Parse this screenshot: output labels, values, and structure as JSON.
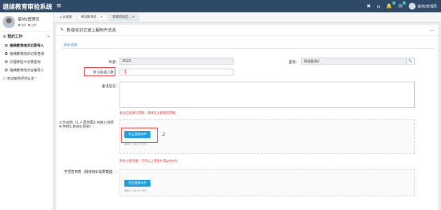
{
  "app": {
    "title": "继续教育审验系统"
  },
  "topbar": {
    "user_name": "基地2管理员",
    "badge_bell": "5",
    "badge_mail": "5"
  },
  "sidebar": {
    "user": {
      "name": "基地2管理员",
      "status_online": "在线",
      "status_work": "工种"
    },
    "section_label": "我的工作",
    "items": [
      {
        "label": "继续教育培训记录导入",
        "active": true
      },
      {
        "label": "继续教育培训记录查询"
      },
      {
        "label": "办理审验卡记录查询"
      },
      {
        "label": "继续教育培训合格导入"
      }
    ],
    "section2_label": "培训基地评估认定"
  },
  "tabs": [
    {
      "label": "仪表盘"
    },
    {
      "label": "继续教育培..."
    },
    {
      "label": "新增培训记..."
    }
  ],
  "panel": {
    "title": "新增培训记录上报附件信息",
    "section": "基本信息",
    "fields": {
      "year_label": "年度:",
      "year_value": "2023",
      "base_label": "基地:",
      "base_value": "测试基地2",
      "count_label": "学习完成人数:",
      "remark_label": "备注信息:",
      "remark_hint": "备注信息填写说明：请填写上报情况说明。",
      "work_summary_label": "工作总结（1.人员范围2.内容3.时间4.学时5.地点6.师资）:",
      "upload_btn": "点击选择文件",
      "upload_hint": "最多可上传10个文件",
      "attach_note": "附件上传说明：只可以上传图片或pdf文件",
      "student_sign_label": "学员签到表（网络培训需要截图）:",
      "upload_btn2": "点击选择文件",
      "upload_hint2": "最多可上传10个文件"
    },
    "markers": {
      "m1": "1",
      "m2": "2"
    }
  }
}
